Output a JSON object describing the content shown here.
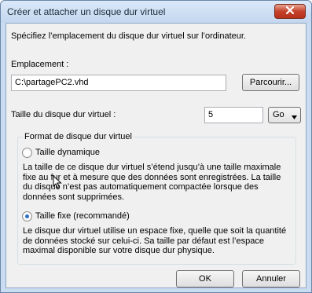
{
  "window": {
    "title": "Créer et attacher un disque dur virtuel"
  },
  "intro": "Spécifiez l’emplacement du disque dur virtuel sur l’ordinateur.",
  "location": {
    "label": "Emplacement :",
    "value": "C:\\partagePC2.vhd",
    "browse_label": "Parcourir..."
  },
  "size": {
    "label": "Taille du disque dur virtuel :",
    "value": "5",
    "unit": "Go"
  },
  "format": {
    "legend": "Format de disque dur virtuel",
    "options": [
      {
        "label": "Taille dynamique",
        "checked": false,
        "desc": [
          "La taille de ce disque dur virtuel s’étend jusqu’à une taille maximale",
          "fixe au fur et à mesure que des données sont enregistrées. La taille",
          "du disque n’est pas automatiquement compactée lorsque des",
          "données sont supprimées."
        ]
      },
      {
        "label": "Taille fixe (recommandé)",
        "checked": true,
        "desc": [
          "Le disque dur virtuel utilise un espace fixe, quelle que soit la quantité",
          "de données stocké sur celui-ci. Sa taille par défaut est l’espace",
          "maximal disponible sur votre disque dur physique."
        ]
      }
    ]
  },
  "buttons": {
    "ok": "OK",
    "cancel": "Annuler"
  },
  "icons": {
    "close": "close-icon",
    "dropdown": "chevron-down-icon",
    "cursor": "mouse-pointer-icon"
  },
  "colors": {
    "titlebar": "#c9dcf2",
    "close_button": "#c4412a",
    "client": "#f0f0f0",
    "radio_dot": "#2a6fc4"
  }
}
